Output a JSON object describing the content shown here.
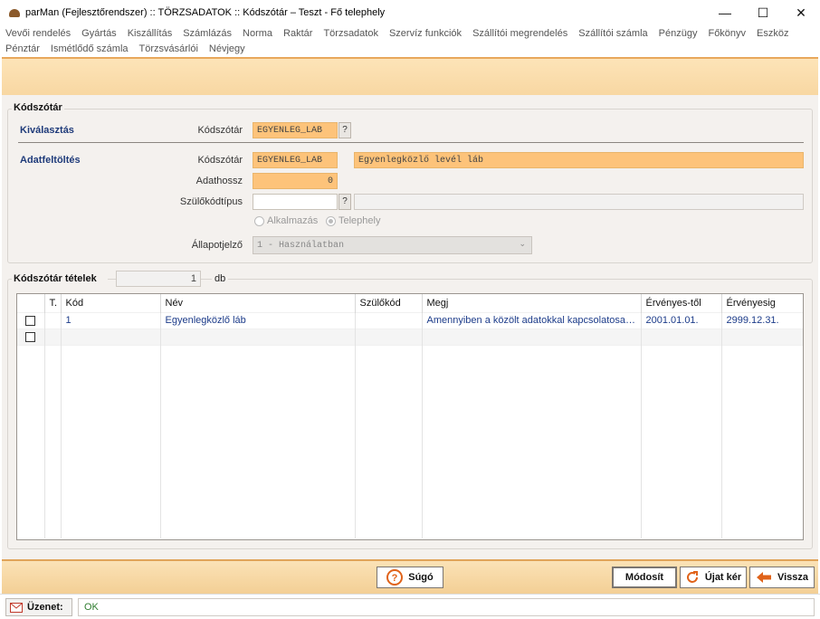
{
  "window": {
    "title": "parMan (Fejlesztőrendszer) :: TÖRZSADATOK :: Kódszótár  –  Teszt - Fő telephely",
    "controls": [
      "—",
      "☐",
      "✕"
    ]
  },
  "menu": [
    "Vevői rendelés",
    "Gyártás",
    "Kiszállítás",
    "Számlázás",
    "Norma",
    "Raktár",
    "Törzsadatok",
    "Szervíz funkciók",
    "Szállítói megrendelés",
    "Szállítói számla",
    "Pénzügy",
    "Főkönyv",
    "Eszköz",
    "Pénztár",
    "Ismétlődő számla",
    "Törzsvásárlói",
    "Névjegy"
  ],
  "kodszotar": {
    "group_title": "Kódszótár",
    "kivalasztas": {
      "label": "Kiválasztás",
      "kod_label": "Kódszótár",
      "kod_value": "EGYENLEG_LAB",
      "lookup": "?"
    },
    "adatfeltoltes": {
      "label": "Adatfeltöltés",
      "kod_label": "Kódszótár",
      "kod_value": "EGYENLEG_LAB",
      "desc_value": "Egyenlegközlő levél láb",
      "adathossz_label": "Adathossz",
      "adathossz_value": "0",
      "szulo_label": "Szülőkódtípus",
      "szulo_value": "",
      "szulo_lookup": "?",
      "radio_alkalmazas": "Alkalmazás",
      "radio_telephely": "Telephely",
      "radio_selected": "Telephely",
      "allapot_label": "Állapotjelző",
      "allapot_value": "1 - Használatban"
    }
  },
  "tetelek": {
    "title": "Kódszótár tételek",
    "count": "1",
    "unit": "db",
    "columns": [
      "",
      "T.",
      "Kód",
      "Név",
      "Szülőkód",
      "Megj",
      "Érvényes-től",
      "Érvényesig"
    ],
    "rows": [
      {
        "checked": false,
        "t": "",
        "kod": "1",
        "nev": "Egyenlegközlő láb",
        "szulokod": "",
        "megj": "Amennyiben a közölt adatokkal kapcsolatosan...",
        "ervenyes_tol": "2001.01.01.",
        "ervenyesig": "2999.12.31."
      },
      {
        "checked": false,
        "t": "",
        "kod": "",
        "nev": "",
        "szulokod": "",
        "megj": "",
        "ervenyes_tol": "",
        "ervenyesig": ""
      }
    ]
  },
  "buttons": {
    "sugo": "Súgó",
    "modosit": "Módosít",
    "ujat_ker": "Újat kér",
    "vissza": "Vissza"
  },
  "status": {
    "label": "Üzenet:",
    "message": "OK"
  },
  "colors": {
    "accent_orange": "#fdc37a",
    "section_blue": "#1f3b7a",
    "status_green": "#2f7d2f"
  }
}
